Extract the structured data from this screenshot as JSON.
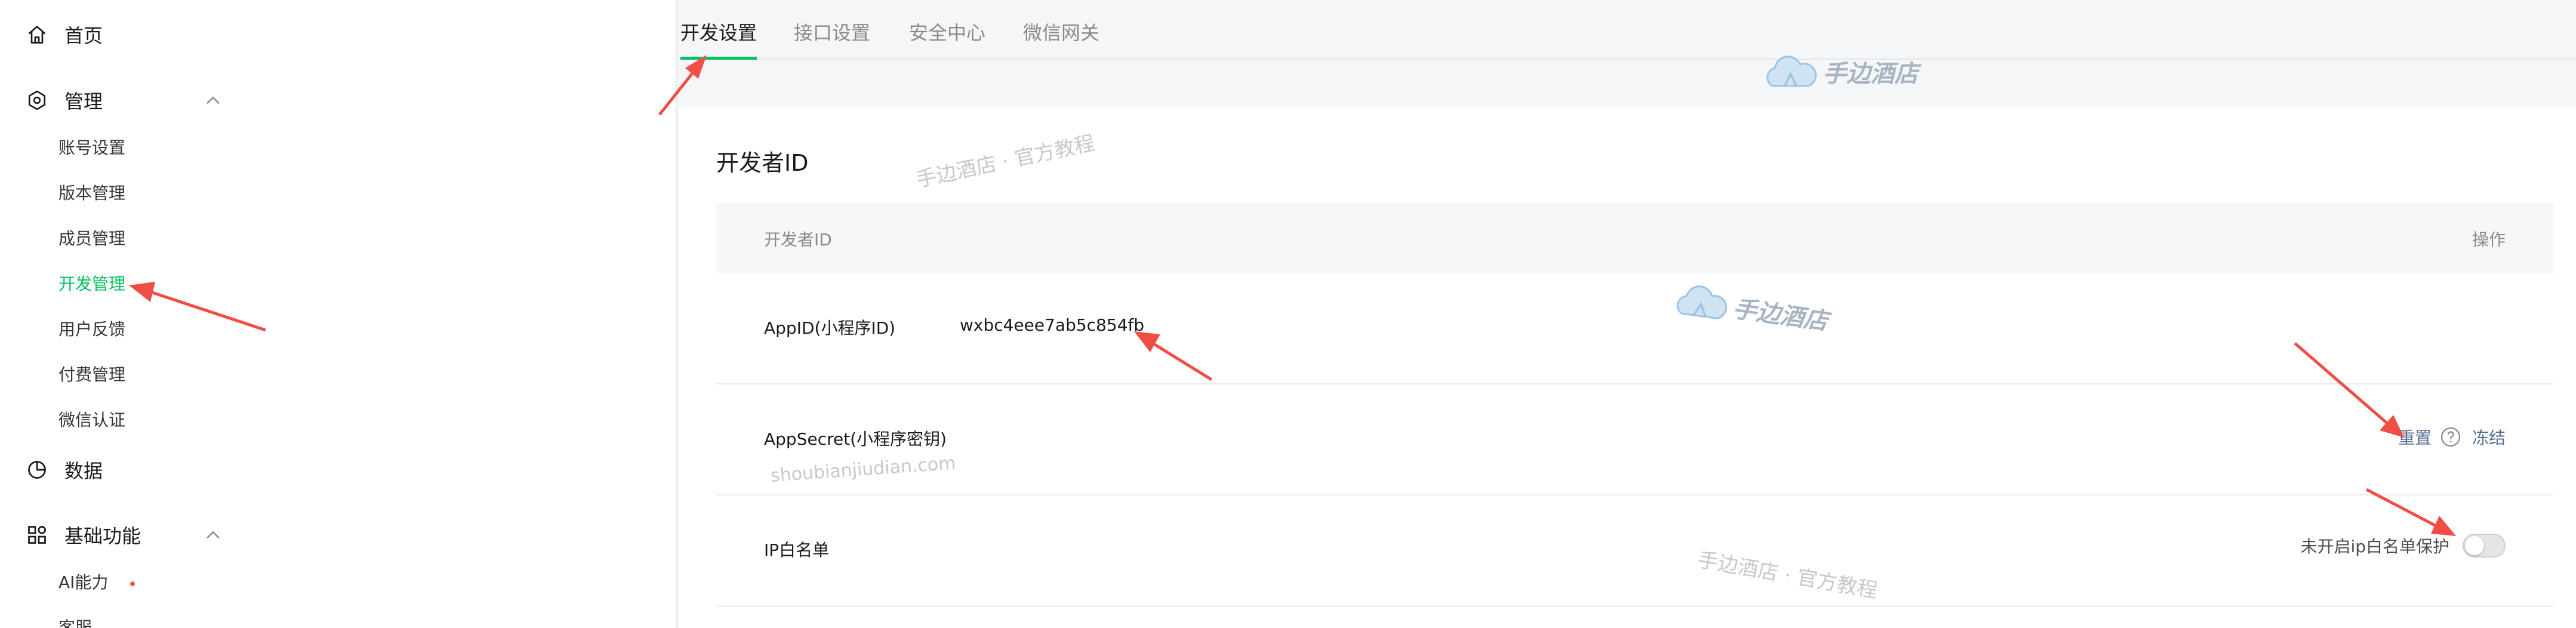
{
  "sidebar": {
    "home": "首页",
    "manage": "管理",
    "manage_items": [
      "账号设置",
      "版本管理",
      "成员管理",
      "开发管理",
      "用户反馈",
      "付费管理",
      "微信认证"
    ],
    "data": "数据",
    "basic": "基础功能",
    "basic_items": [
      "AI能力",
      "客服"
    ]
  },
  "tabs": [
    "开发设置",
    "接口设置",
    "安全中心",
    "微信网关"
  ],
  "card": {
    "title": "开发者ID",
    "headers": {
      "name": "开发者ID",
      "ops": "操作"
    },
    "rows": {
      "appid": {
        "label": "AppID(小程序ID)",
        "value": "wxbc4eee7ab5c854fb"
      },
      "secret": {
        "label": "AppSecret(小程序密钥)",
        "reset": "重置",
        "freeze": "冻结"
      },
      "ip": {
        "label": "IP白名单",
        "status": "未开启ip白名单保护"
      }
    }
  },
  "watermarks": {
    "brand": "手边酒店",
    "tutorial": "手边酒店 · 官方教程",
    "domain": "shoubianjiudian.com"
  },
  "colors": {
    "accent": "#07c160",
    "link": "#576b95",
    "annotation_arrow": "#f04e45",
    "dot": "#fa5151"
  }
}
